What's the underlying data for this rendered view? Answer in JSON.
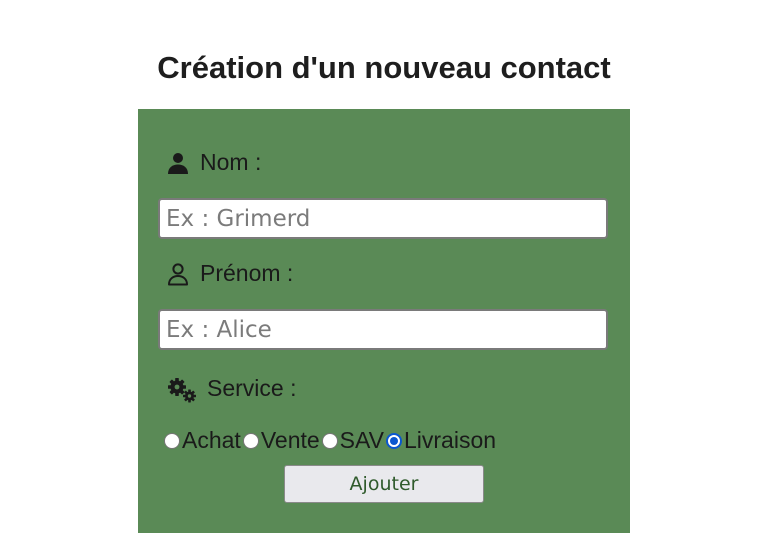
{
  "page": {
    "title": "Création d'un nouveau contact"
  },
  "form": {
    "background_color": "#5a8a56",
    "nom": {
      "label": "Nom :",
      "icon": "user-solid-icon",
      "value": "",
      "placeholder": "Ex : Grimerd"
    },
    "prenom": {
      "label": "Prénom :",
      "icon": "user-outline-icon",
      "value": "",
      "placeholder": "Ex : Alice"
    },
    "service": {
      "label": "Service :",
      "icon": "gears-icon",
      "options": [
        {
          "label": "Achat",
          "checked": false
        },
        {
          "label": "Vente",
          "checked": false
        },
        {
          "label": "SAV",
          "checked": false
        },
        {
          "label": "Livraison",
          "checked": true
        }
      ],
      "selected": "Livraison"
    },
    "submit_label": "Ajouter"
  }
}
